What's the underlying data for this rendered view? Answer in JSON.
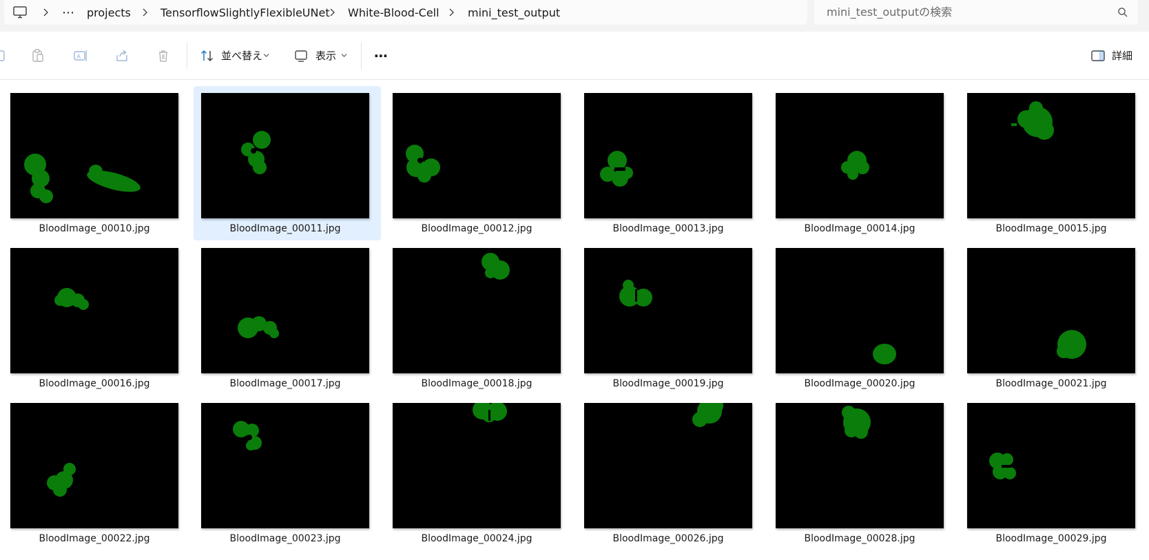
{
  "breadcrumb": {
    "overflow": "⋯",
    "items": [
      "projects",
      "TensorflowSlightlyFlexibleUNet",
      "White-Blood-Cell",
      "mini_test_output"
    ]
  },
  "search": {
    "placeholder": "mini_test_outputの検索"
  },
  "toolbar": {
    "sort_label": "並べ替え",
    "view_label": "表示",
    "more_label": "⋯",
    "details_label": "詳細"
  },
  "colors": {
    "mask": "#0a7d0a",
    "selection": "#e2efff",
    "accent": "#1a73c8"
  },
  "files": [
    {
      "name": "BloodImage_00010.jpg",
      "selected": false
    },
    {
      "name": "BloodImage_00011.jpg",
      "selected": true
    },
    {
      "name": "BloodImage_00012.jpg",
      "selected": false
    },
    {
      "name": "BloodImage_00013.jpg",
      "selected": false
    },
    {
      "name": "BloodImage_00014.jpg",
      "selected": false
    },
    {
      "name": "BloodImage_00015.jpg",
      "selected": false
    },
    {
      "name": "BloodImage_00016.jpg",
      "selected": false
    },
    {
      "name": "BloodImage_00017.jpg",
      "selected": false
    },
    {
      "name": "BloodImage_00018.jpg",
      "selected": false
    },
    {
      "name": "BloodImage_00019.jpg",
      "selected": false
    },
    {
      "name": "BloodImage_00020.jpg",
      "selected": false
    },
    {
      "name": "BloodImage_00021.jpg",
      "selected": false
    },
    {
      "name": "BloodImage_00022.jpg",
      "selected": false
    },
    {
      "name": "BloodImage_00023.jpg",
      "selected": false
    },
    {
      "name": "BloodImage_00024.jpg",
      "selected": false
    },
    {
      "name": "BloodImage_00026.jpg",
      "selected": false
    },
    {
      "name": "BloodImage_00028.jpg",
      "selected": false
    },
    {
      "name": "BloodImage_00029.jpg",
      "selected": false
    }
  ]
}
